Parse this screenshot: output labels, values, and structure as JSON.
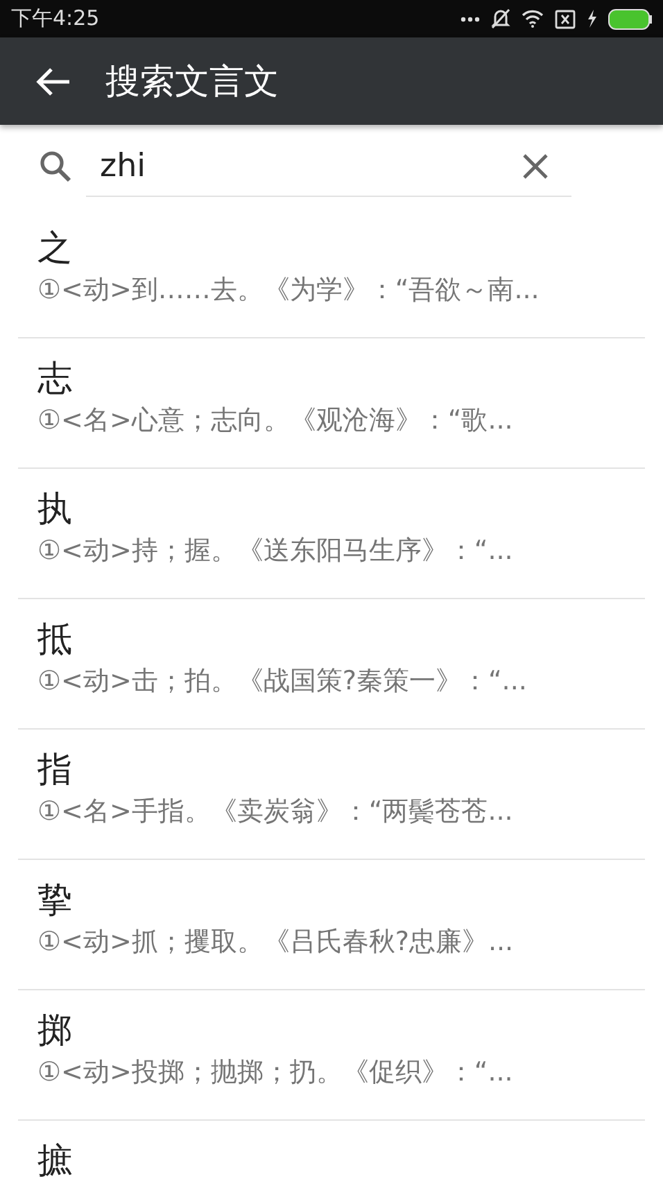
{
  "status_bar": {
    "time": "下午4:25"
  },
  "app_bar": {
    "title": "搜索文言文"
  },
  "search": {
    "value": "zhi"
  },
  "results": [
    {
      "character": "之",
      "definition": "①<动>到……去。《为学》：“吾欲～南..."
    },
    {
      "character": "志",
      "definition": "①<名>心意；志向。《观沧海》：“歌..."
    },
    {
      "character": "执",
      "definition": "①<动>持；握。《送东阳马生序》：“..."
    },
    {
      "character": "抵",
      "definition": "①<动>击；拍。《战国策?秦策一》：“..."
    },
    {
      "character": "指",
      "definition": "①<名>手指。《卖炭翁》：“两鬓苍苍..."
    },
    {
      "character": "挚",
      "definition": "①<动>抓；攫取。《吕氏春秋?忠廉》..."
    },
    {
      "character": "掷",
      "definition": "①<动>投掷；抛掷；扔。《促织》：“..."
    },
    {
      "character": "摭"
    }
  ]
}
